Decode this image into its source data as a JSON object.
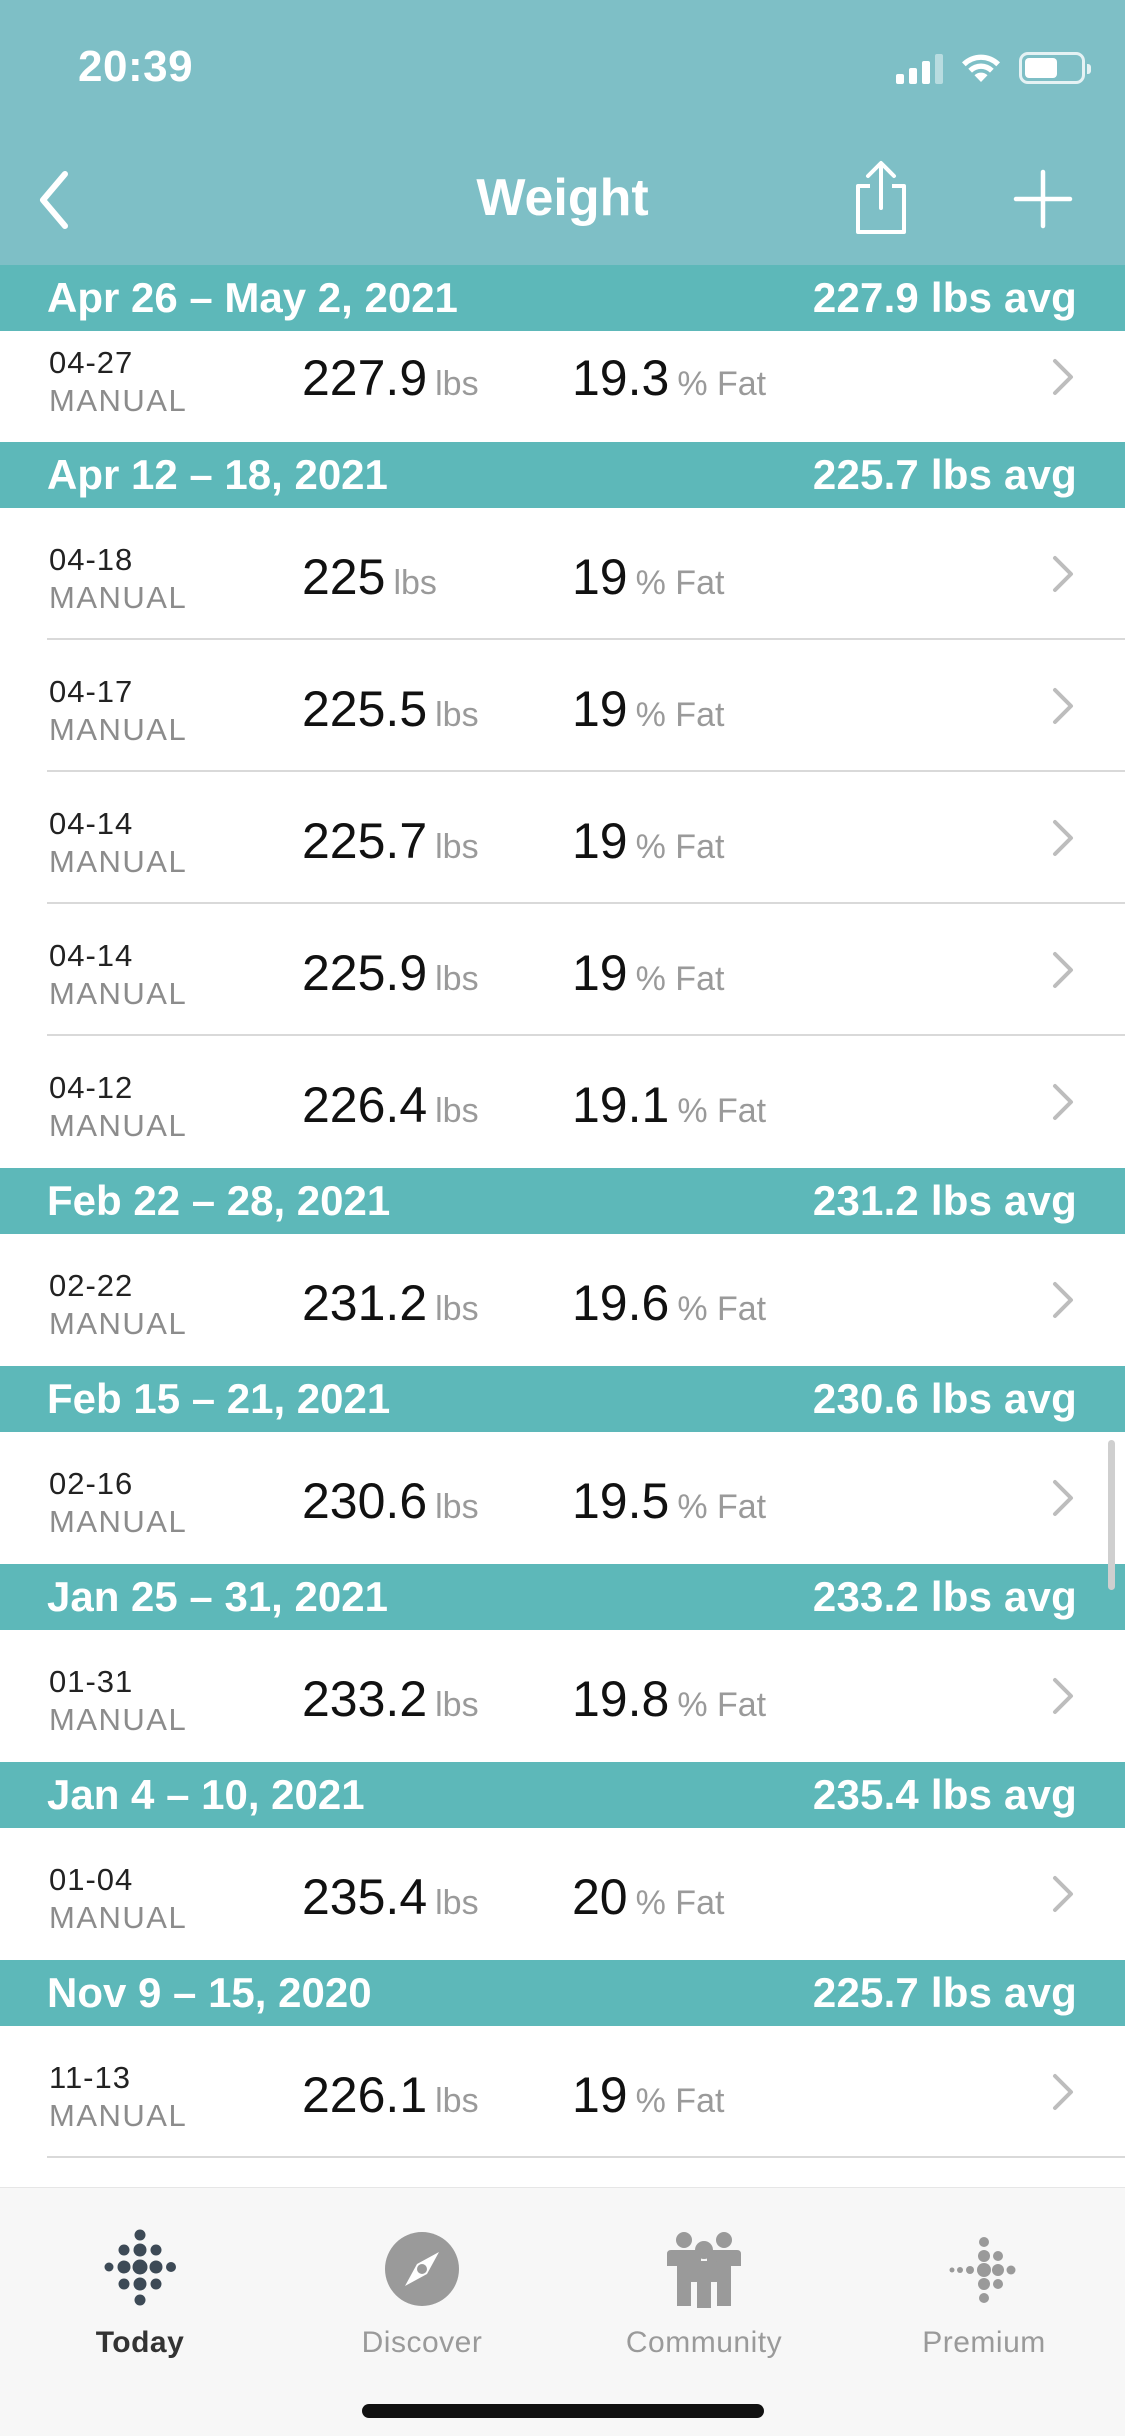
{
  "status_bar": {
    "time": "20:39"
  },
  "nav": {
    "title": "Weight"
  },
  "colors": {
    "header": "#7ebfc6",
    "week_bar": "#5db8b9"
  },
  "icons": {
    "back": "chevron-left-icon",
    "share": "share-icon",
    "add": "plus-icon",
    "row": "chevron-right-icon"
  },
  "weeks": [
    {
      "range": "Apr 26 – May 2, 2021",
      "avg": "227.9 lbs avg",
      "entries": [
        {
          "date": "04-27",
          "source": "MANUAL",
          "weight": "227.9",
          "unit": "lbs",
          "fat": "19.3",
          "fat_unit": "% Fat"
        }
      ]
    },
    {
      "range": "Apr 12 – 18, 2021",
      "avg": "225.7 lbs avg",
      "entries": [
        {
          "date": "04-18",
          "source": "MANUAL",
          "weight": "225",
          "unit": "lbs",
          "fat": "19",
          "fat_unit": "% Fat"
        },
        {
          "date": "04-17",
          "source": "MANUAL",
          "weight": "225.5",
          "unit": "lbs",
          "fat": "19",
          "fat_unit": "% Fat"
        },
        {
          "date": "04-14",
          "source": "MANUAL",
          "weight": "225.7",
          "unit": "lbs",
          "fat": "19",
          "fat_unit": "% Fat"
        },
        {
          "date": "04-14",
          "source": "MANUAL",
          "weight": "225.9",
          "unit": "lbs",
          "fat": "19",
          "fat_unit": "% Fat"
        },
        {
          "date": "04-12",
          "source": "MANUAL",
          "weight": "226.4",
          "unit": "lbs",
          "fat": "19.1",
          "fat_unit": "% Fat"
        }
      ]
    },
    {
      "range": "Feb 22 – 28, 2021",
      "avg": "231.2 lbs avg",
      "entries": [
        {
          "date": "02-22",
          "source": "MANUAL",
          "weight": "231.2",
          "unit": "lbs",
          "fat": "19.6",
          "fat_unit": "% Fat"
        }
      ]
    },
    {
      "range": "Feb 15 – 21, 2021",
      "avg": "230.6 lbs avg",
      "entries": [
        {
          "date": "02-16",
          "source": "MANUAL",
          "weight": "230.6",
          "unit": "lbs",
          "fat": "19.5",
          "fat_unit": "% Fat"
        }
      ]
    },
    {
      "range": "Jan 25 – 31, 2021",
      "avg": "233.2 lbs avg",
      "entries": [
        {
          "date": "01-31",
          "source": "MANUAL",
          "weight": "233.2",
          "unit": "lbs",
          "fat": "19.8",
          "fat_unit": "% Fat"
        }
      ]
    },
    {
      "range": "Jan 4 – 10, 2021",
      "avg": "235.4 lbs avg",
      "entries": [
        {
          "date": "01-04",
          "source": "MANUAL",
          "weight": "235.4",
          "unit": "lbs",
          "fat": "20",
          "fat_unit": "% Fat"
        }
      ]
    },
    {
      "range": "Nov 9 – 15, 2020",
      "avg": "225.7 lbs avg",
      "entries": [
        {
          "date": "11-13",
          "source": "MANUAL",
          "weight": "226.1",
          "unit": "lbs",
          "fat": "19",
          "fat_unit": "% Fat"
        }
      ]
    }
  ],
  "tabbar": {
    "tabs": [
      {
        "label": "Today",
        "icon": "fitbit-dots-icon",
        "active": true
      },
      {
        "label": "Discover",
        "icon": "compass-icon",
        "active": false
      },
      {
        "label": "Community",
        "icon": "community-people-icon",
        "active": false
      },
      {
        "label": "Premium",
        "icon": "premium-dots-icon",
        "active": false
      }
    ]
  }
}
